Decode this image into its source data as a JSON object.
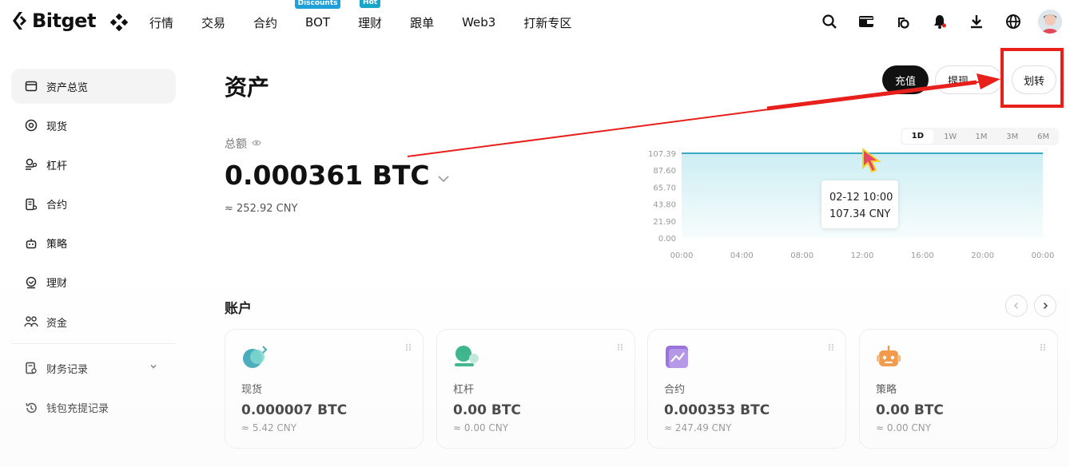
{
  "brand": {
    "name": "Bitget"
  },
  "nav": {
    "items": [
      {
        "label": "行情",
        "badge": ""
      },
      {
        "label": "交易",
        "badge": ""
      },
      {
        "label": "合约",
        "badge": ""
      },
      {
        "label": "BOT",
        "badge": "Discounts"
      },
      {
        "label": "理财",
        "badge": "Hot"
      },
      {
        "label": "跟单",
        "badge": ""
      },
      {
        "label": "Web3",
        "badge": ""
      },
      {
        "label": "打新专区",
        "badge": ""
      }
    ],
    "icons": [
      "search-icon",
      "wallet-icon",
      "coin-icon",
      "bell-icon",
      "download-icon",
      "globe-icon"
    ]
  },
  "sidebar": {
    "items": [
      {
        "label": "资产总览",
        "icon": "wallet-icon"
      },
      {
        "label": "现货",
        "icon": "target-icon"
      },
      {
        "label": "杠杆",
        "icon": "leverage-icon"
      },
      {
        "label": "合约",
        "icon": "contract-icon"
      },
      {
        "label": "策略",
        "icon": "robot-icon"
      },
      {
        "label": "理财",
        "icon": "finance-icon"
      },
      {
        "label": "资金",
        "icon": "people-icon"
      }
    ],
    "records": [
      {
        "label": "财务记录",
        "icon": "record-icon"
      },
      {
        "label": "钱包充提记录",
        "icon": "history-icon"
      }
    ]
  },
  "main": {
    "title": "资产",
    "buttons": {
      "deposit": "充值",
      "withdraw": "提现",
      "transfer": "划转"
    },
    "total": {
      "label": "总额",
      "value": "0.000361 BTC",
      "cny": "≈ 252.92 CNY"
    },
    "range_tabs": [
      "1D",
      "1W",
      "1M",
      "3M",
      "6M"
    ],
    "active_range": "1D",
    "tooltip": {
      "time": "02-12 10:00",
      "value": "107.34 CNY"
    },
    "accounts_title": "账户",
    "accounts": [
      {
        "name": "现货",
        "value": "0.000007 BTC",
        "cny": "≈ 5.42 CNY",
        "color": "#2fae9a"
      },
      {
        "name": "杠杆",
        "value": "0.00 BTC",
        "cny": "≈ 0.00 CNY",
        "color": "#1faa7c"
      },
      {
        "name": "合约",
        "value": "0.000353 BTC",
        "cny": "≈ 247.49 CNY",
        "color": "#8a5cd6"
      },
      {
        "name": "策略",
        "value": "0.00 BTC",
        "cny": "≈ 0.00 CNY",
        "color": "#f08a2c"
      }
    ]
  },
  "chart_data": {
    "type": "area",
    "x": [
      "00:00",
      "04:00",
      "08:00",
      "12:00",
      "16:00",
      "20:00",
      "00:00"
    ],
    "values": [
      107.34,
      107.34,
      107.34,
      107.34,
      107.34,
      107.34,
      107.34
    ],
    "yticks": [
      "107.39",
      "87.60",
      "65.70",
      "43.80",
      "21.90",
      "0.00"
    ],
    "ylim": [
      0,
      107.39
    ],
    "line_color": "#39a9c4",
    "fill_color": "#cdeef3"
  },
  "accent": {
    "highlight": "#e8201c"
  }
}
